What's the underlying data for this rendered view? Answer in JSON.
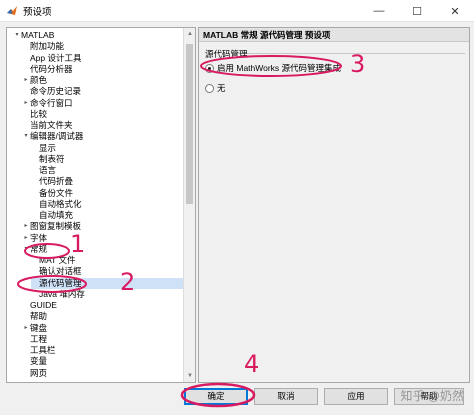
{
  "window": {
    "title": "预设项",
    "minimize": "—",
    "maximize": "☐",
    "close": "✕"
  },
  "tree": [
    {
      "label": "MATLAB",
      "indent": 0,
      "toggle": "▾"
    },
    {
      "label": "附加功能",
      "indent": 1,
      "toggle": ""
    },
    {
      "label": "App 设计工具",
      "indent": 1,
      "toggle": ""
    },
    {
      "label": "代码分析器",
      "indent": 1,
      "toggle": ""
    },
    {
      "label": "颜色",
      "indent": 1,
      "toggle": "▸"
    },
    {
      "label": "命令历史记录",
      "indent": 1,
      "toggle": ""
    },
    {
      "label": "命令行窗口",
      "indent": 1,
      "toggle": "▸"
    },
    {
      "label": "比较",
      "indent": 1,
      "toggle": ""
    },
    {
      "label": "当前文件夹",
      "indent": 1,
      "toggle": ""
    },
    {
      "label": "编辑器/调试器",
      "indent": 1,
      "toggle": "▾"
    },
    {
      "label": "显示",
      "indent": 2,
      "toggle": ""
    },
    {
      "label": "制表符",
      "indent": 2,
      "toggle": ""
    },
    {
      "label": "语言",
      "indent": 2,
      "toggle": ""
    },
    {
      "label": "代码折叠",
      "indent": 2,
      "toggle": ""
    },
    {
      "label": "备份文件",
      "indent": 2,
      "toggle": ""
    },
    {
      "label": "自动格式化",
      "indent": 2,
      "toggle": ""
    },
    {
      "label": "自动填充",
      "indent": 2,
      "toggle": ""
    },
    {
      "label": "图窗复制模板",
      "indent": 1,
      "toggle": "▸"
    },
    {
      "label": "字体",
      "indent": 1,
      "toggle": "▸"
    },
    {
      "label": "常规",
      "indent": 1,
      "toggle": "▾"
    },
    {
      "label": "MAT 文件",
      "indent": 2,
      "toggle": ""
    },
    {
      "label": "确认对话框",
      "indent": 2,
      "toggle": ""
    },
    {
      "label": "源代码管理",
      "indent": 2,
      "toggle": "",
      "selected": true
    },
    {
      "label": "Java 堆内存",
      "indent": 2,
      "toggle": ""
    },
    {
      "label": "GUIDE",
      "indent": 1,
      "toggle": ""
    },
    {
      "label": "帮助",
      "indent": 1,
      "toggle": ""
    },
    {
      "label": "键盘",
      "indent": 1,
      "toggle": "▸"
    },
    {
      "label": "工程",
      "indent": 1,
      "toggle": ""
    },
    {
      "label": "工具栏",
      "indent": 1,
      "toggle": ""
    },
    {
      "label": "变量",
      "indent": 1,
      "toggle": ""
    },
    {
      "label": "网页",
      "indent": 1,
      "toggle": ""
    }
  ],
  "panel": {
    "header": "MATLAB 常规 源代码管理 预设项",
    "group_label": "源代码管理",
    "options": [
      {
        "label": "启用 MathWorks 源代码管理集成",
        "checked": true
      },
      {
        "label": "无",
        "checked": false
      }
    ]
  },
  "buttons": {
    "ok": "确定",
    "cancel": "取消",
    "apply": "应用",
    "help": "帮助"
  },
  "annotations": {
    "n1": "1",
    "n2": "2",
    "n3": "3",
    "n4": "4"
  },
  "watermark": "知乎 @奶然",
  "colors": {
    "annotation": "#d81b60",
    "selection": "#cfe1f7",
    "matlab_orange": "#e16a1c"
  },
  "icons": {
    "app": "matlab-logo-icon"
  }
}
